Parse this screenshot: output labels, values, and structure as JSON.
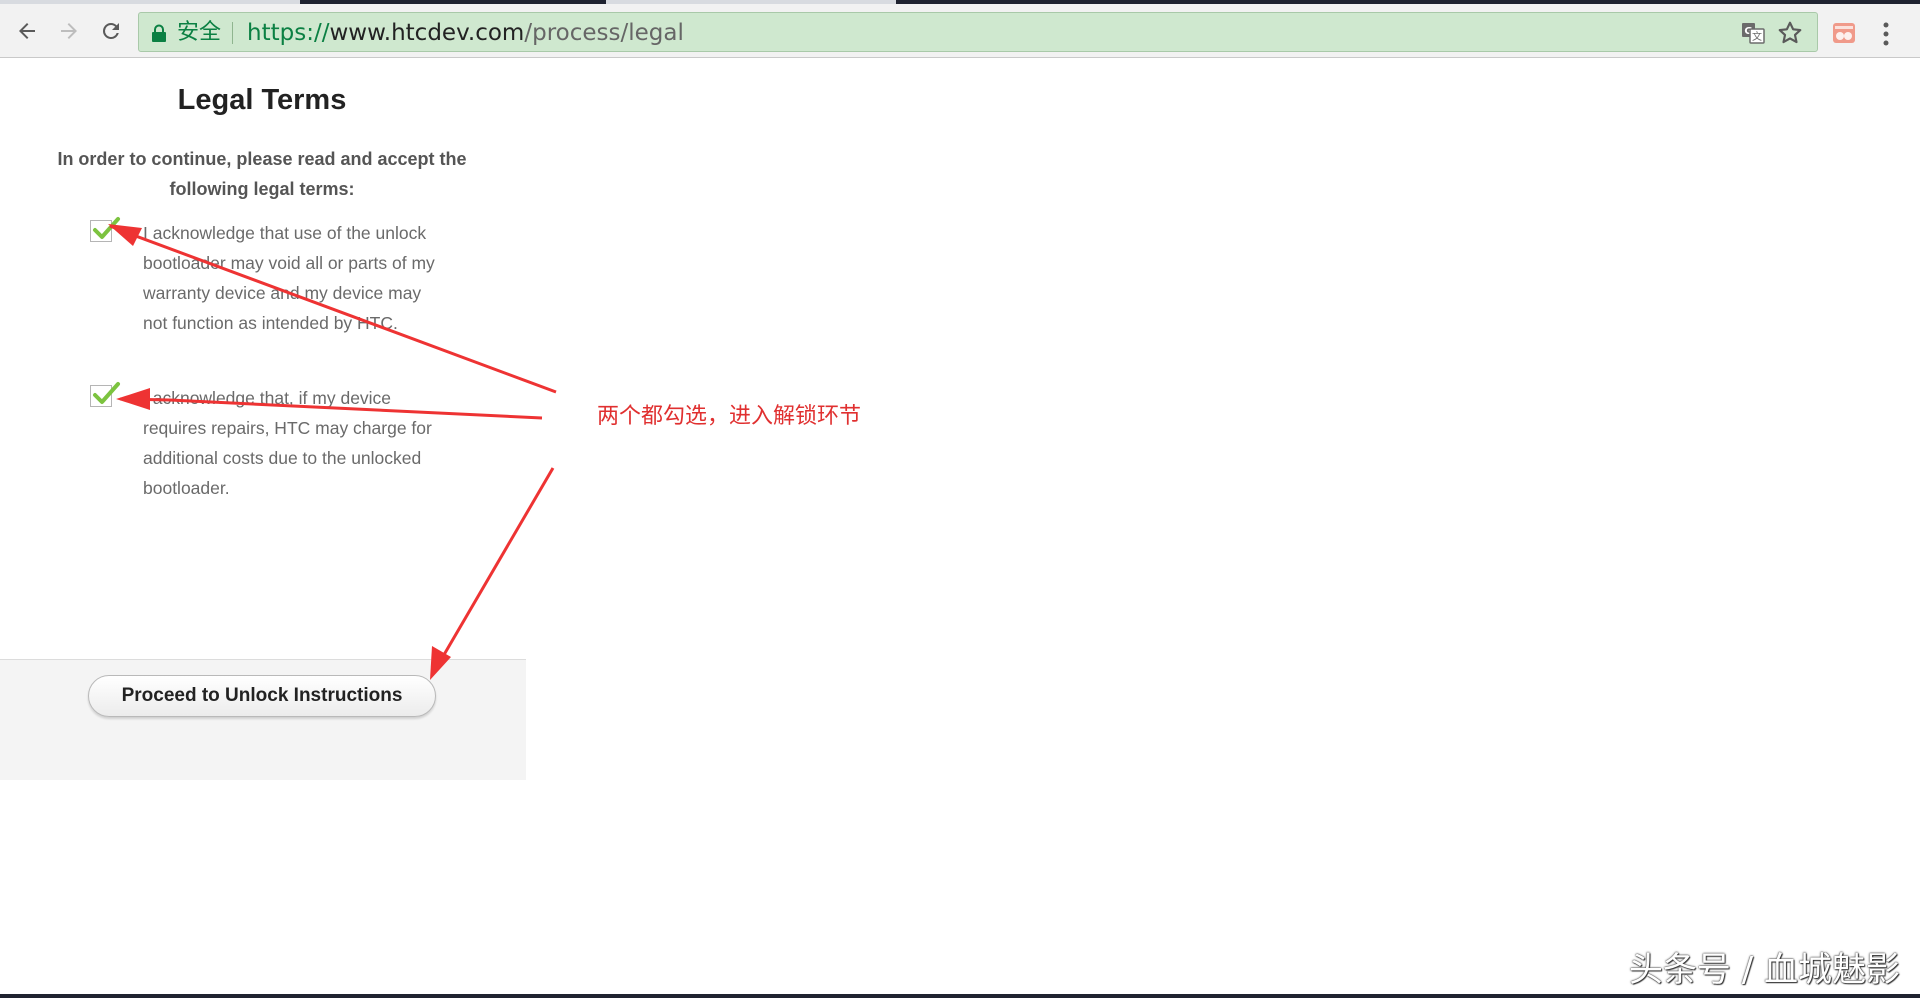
{
  "browser": {
    "secure_label": "安全",
    "url_scheme": "https://",
    "url_host": "www.htcdev.com",
    "url_path": "/process/legal",
    "icons": [
      "back-arrow-icon",
      "forward-arrow-icon",
      "reload-icon",
      "lock-icon",
      "translate-icon",
      "star-icon",
      "extension-icon",
      "menu-icon"
    ],
    "accent_color": "#0b8043"
  },
  "page": {
    "title": "Legal Terms",
    "intro": "In order to continue, please read and accept the following legal terms:",
    "terms": [
      {
        "checked": true,
        "text": "I acknowledge that use of the unlock bootloader may void all or parts of my warranty device and my device may not function as intended by HTC."
      },
      {
        "checked": true,
        "text": "I acknowledge that, if my device requires repairs, HTC may charge for additional costs due to the unlocked bootloader."
      }
    ],
    "proceed_button": "Proceed to Unlock Instructions"
  },
  "annotation": {
    "text": "两个都勾选，进入解锁环节",
    "color": "#e03030"
  },
  "watermark": "头条号 / 血城魅影"
}
